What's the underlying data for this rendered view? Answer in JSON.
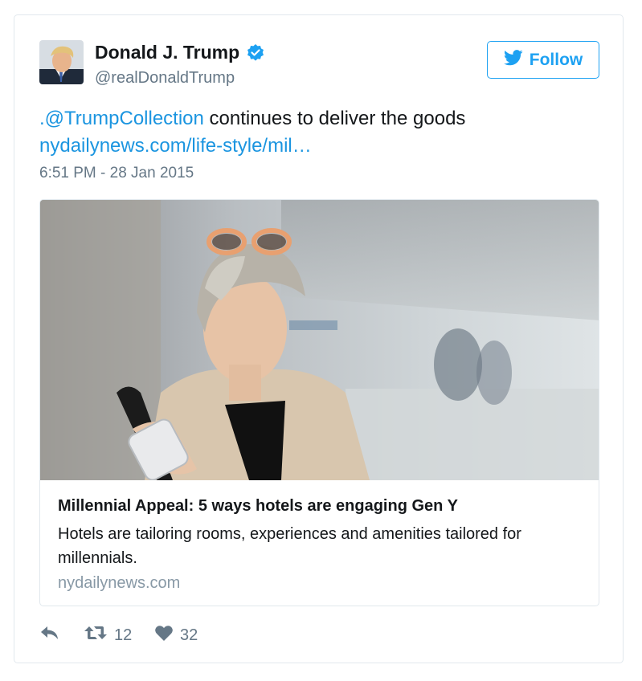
{
  "tweet": {
    "display_name": "Donald J. Trump",
    "handle": "@realDonaldTrump",
    "verified_icon": "verified-check-icon",
    "follow_label": "Follow",
    "text_mention": ".@TrumpCollection",
    "text_body": " continues to deliver the goods",
    "text_link": "nydailynews.com/life-style/mil…",
    "timestamp": "6:51 PM - 28 Jan 2015"
  },
  "card": {
    "title": "Millennial Appeal: 5 ways hotels are engaging Gen Y",
    "description": "Hotels are tailoring rooms, experiences and amenities tailored for millennials.",
    "domain": "nydailynews.com"
  },
  "actions": {
    "reply_icon": "reply-icon",
    "retweet_icon": "retweet-icon",
    "retweet_count": "12",
    "like_icon": "heart-icon",
    "like_count": "32"
  },
  "colors": {
    "accent": "#1da1f2",
    "link": "#1b95e0",
    "muted": "#657786",
    "border": "#e1e8ed"
  }
}
